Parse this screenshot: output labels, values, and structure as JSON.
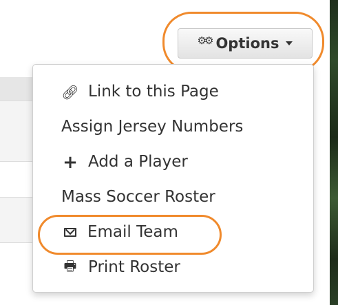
{
  "options_button": {
    "label": "Options",
    "icon": "gears-icon"
  },
  "menu": {
    "items": [
      {
        "label": "Link to this Page",
        "icon": "link-icon"
      },
      {
        "label": "Assign Jersey Numbers",
        "icon": ""
      },
      {
        "label": "Add a Player",
        "icon": "plus-icon"
      },
      {
        "label": "Mass Soccer Roster",
        "icon": ""
      },
      {
        "label": "Email Team",
        "icon": "envelope-icon"
      },
      {
        "label": "Print Roster",
        "icon": "printer-icon"
      }
    ]
  },
  "colors": {
    "highlight_ring": "#f08a2c",
    "text": "#333333",
    "menu_border": "#cfcfcf"
  }
}
